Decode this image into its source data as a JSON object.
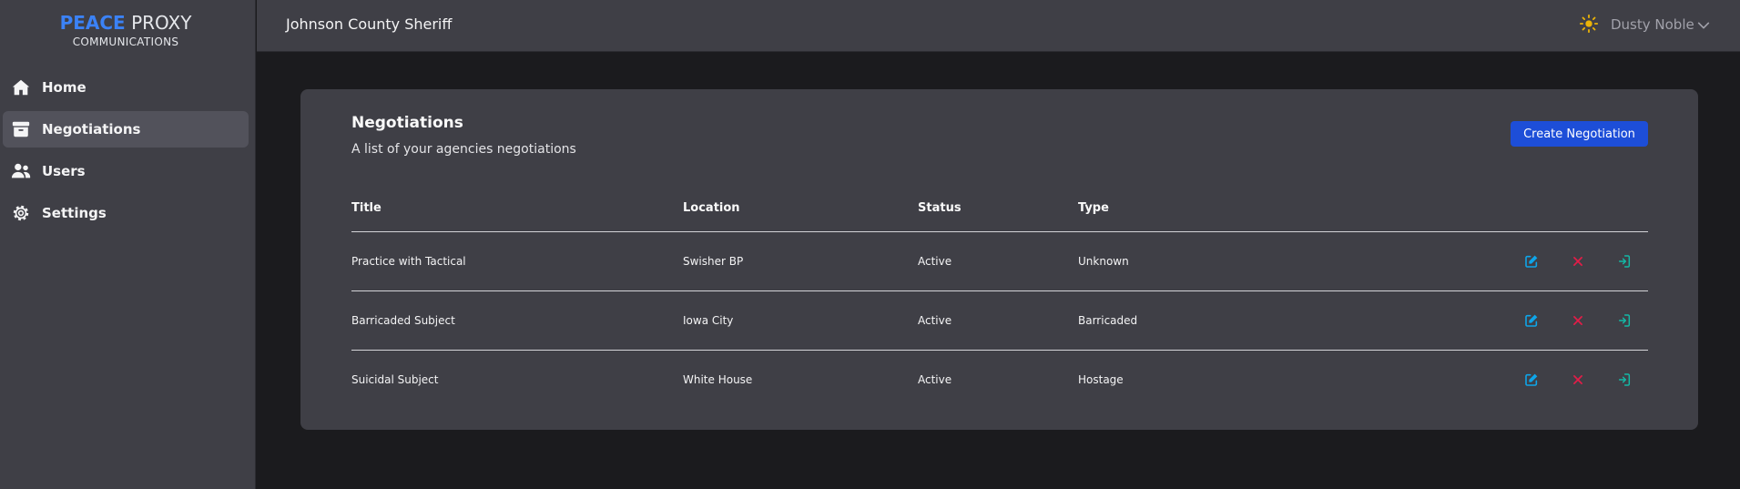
{
  "logo": {
    "part1": "PEACE",
    "part2": "PROXY",
    "subtitle": "COMMUNICATIONS"
  },
  "sidebar": {
    "items": [
      {
        "label": "Home",
        "icon": "home-icon"
      },
      {
        "label": "Negotiations",
        "icon": "archive-box-icon",
        "active": true
      },
      {
        "label": "Users",
        "icon": "users-icon"
      },
      {
        "label": "Settings",
        "icon": "gear-icon"
      }
    ]
  },
  "header": {
    "agency": "Johnson County Sheriff",
    "user": "Dusty Noble",
    "theme_icon": "sun-icon"
  },
  "main": {
    "title": "Negotiations",
    "subtitle": "A list of your agencies negotiations",
    "create_label": "Create Negotiation",
    "columns": [
      "Title",
      "Location",
      "Status",
      "Type"
    ],
    "rows": [
      {
        "title": "Practice with Tactical",
        "location": "Swisher BP",
        "status": "Active",
        "type": "Unknown"
      },
      {
        "title": "Barricaded Subject",
        "location": "Iowa City",
        "status": "Active",
        "type": "Barricaded"
      },
      {
        "title": "Suicidal Subject",
        "location": "White House",
        "status": "Active",
        "type": "Hostage"
      }
    ]
  },
  "colors": {
    "accent": "#1d4ed8",
    "brand": "#3b82f6",
    "edit": "#0ea5e9",
    "delete": "#e11d48",
    "enter": "#14b8a6",
    "sun": "#eab308"
  }
}
